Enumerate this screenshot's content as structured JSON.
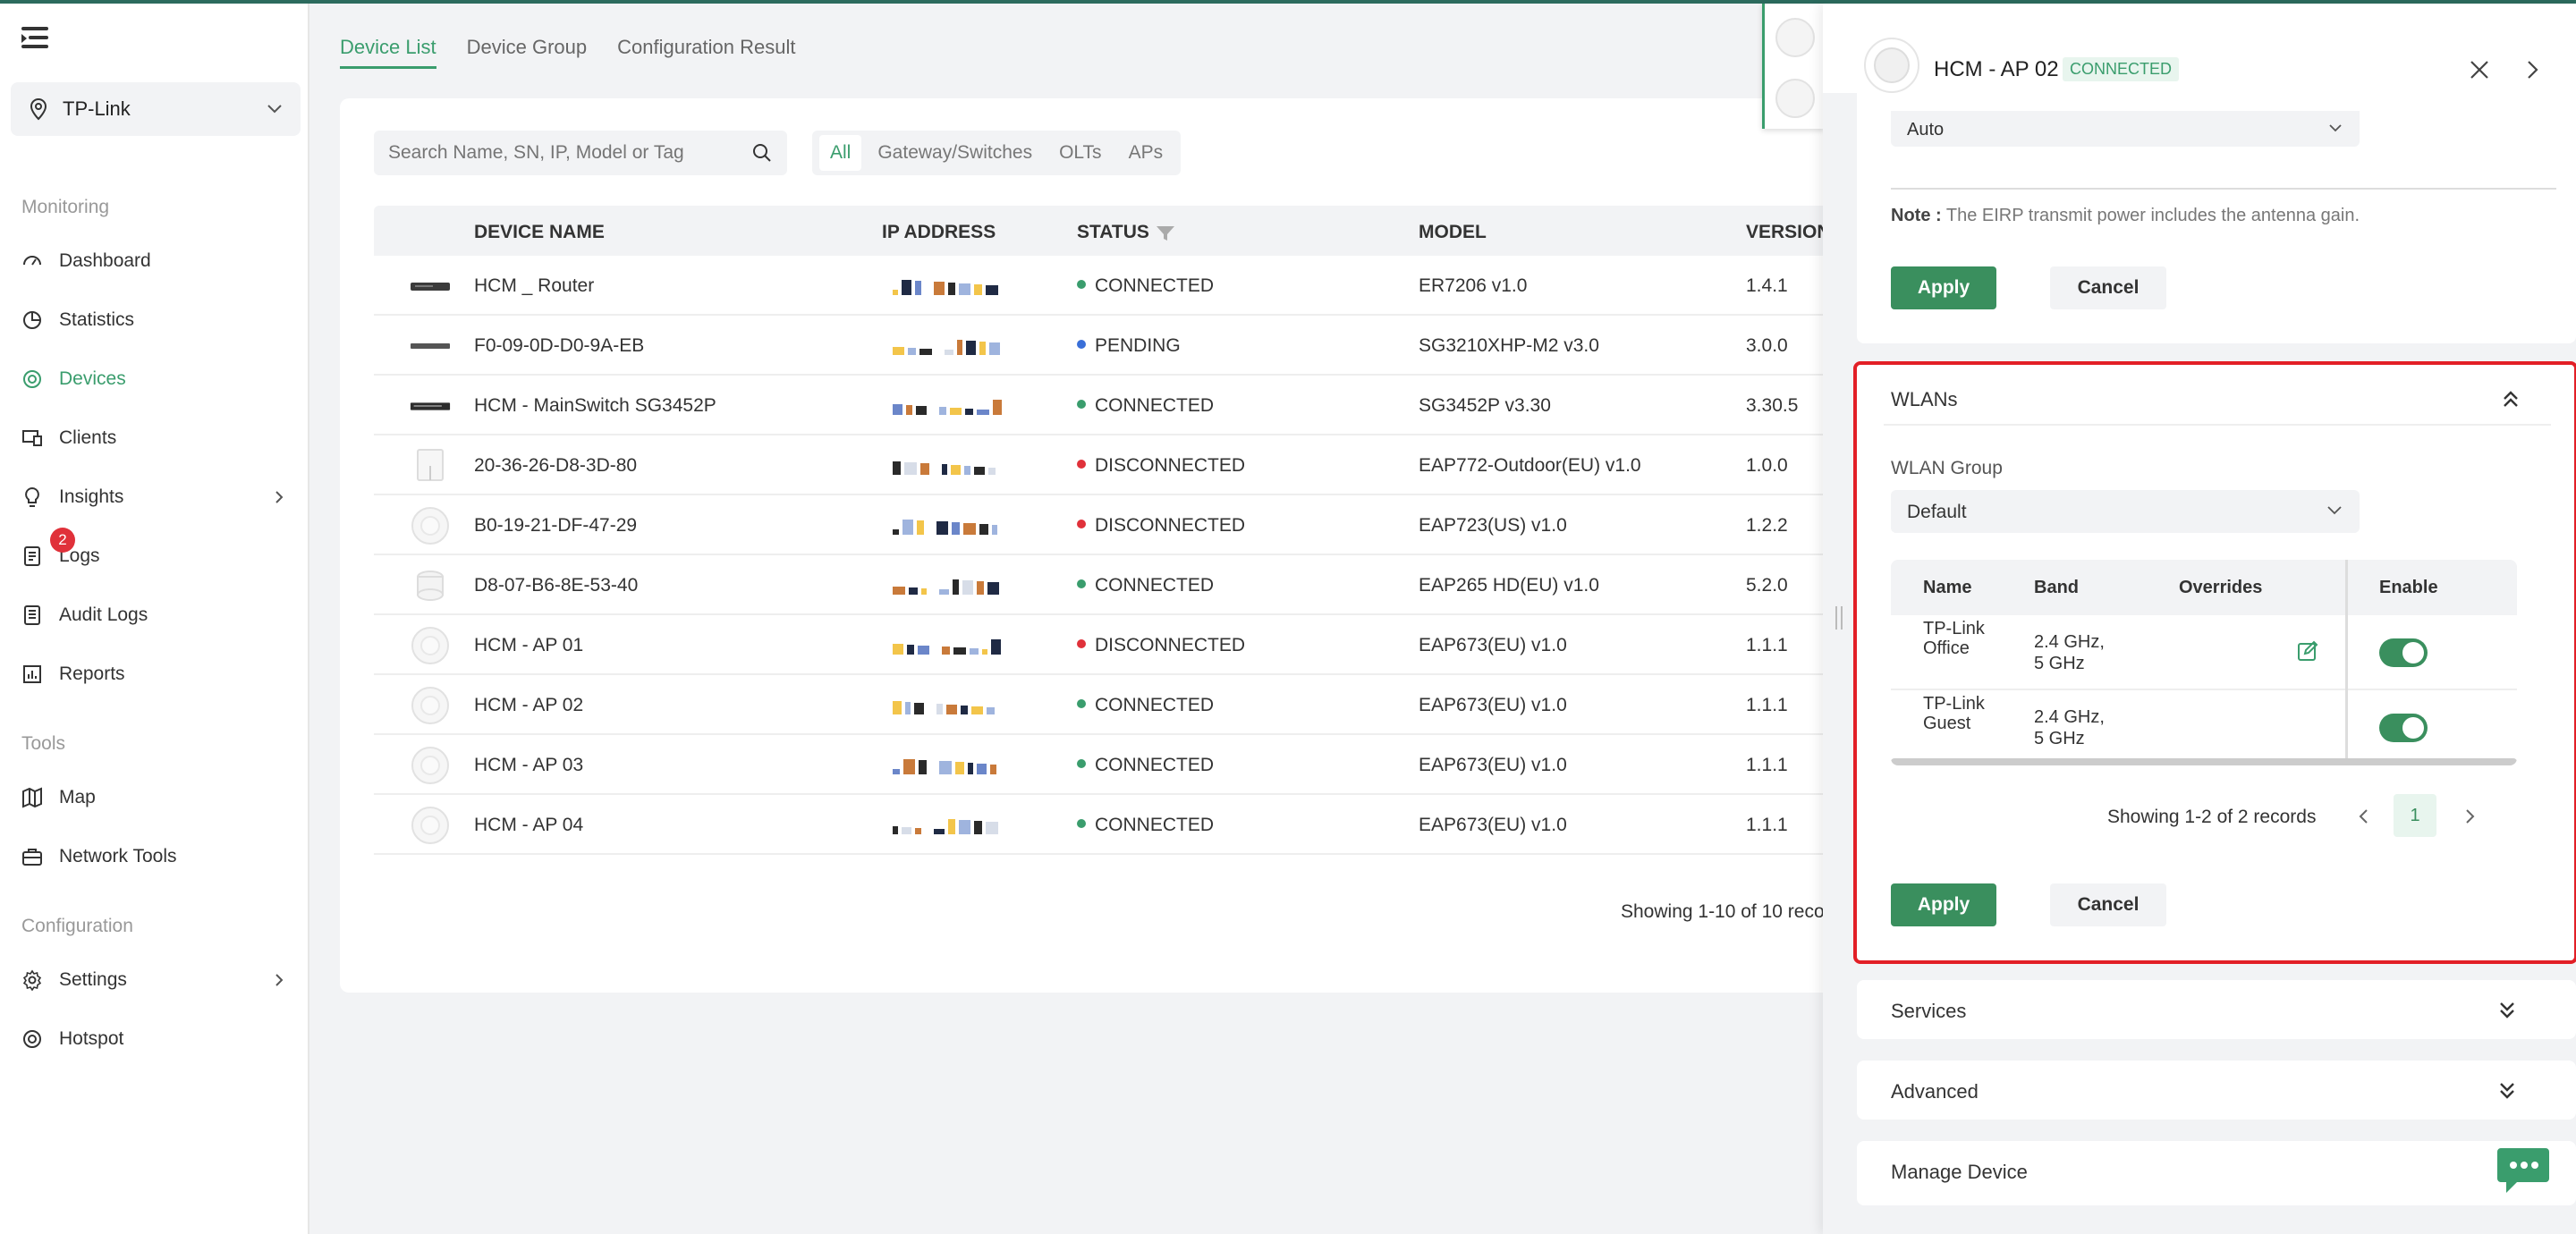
{
  "sidebar": {
    "site": "TP-Link",
    "sections": {
      "monitoring": "Monitoring",
      "tools": "Tools",
      "configuration": "Configuration"
    },
    "items": [
      {
        "label": "Dashboard",
        "icon": "dashboard-icon"
      },
      {
        "label": "Statistics",
        "icon": "pie-chart-icon"
      },
      {
        "label": "Devices",
        "icon": "devices-icon",
        "active": true
      },
      {
        "label": "Clients",
        "icon": "clients-icon"
      },
      {
        "label": "Insights",
        "icon": "bulb-icon"
      },
      {
        "label": "Logs",
        "icon": "logs-icon",
        "badge": "2"
      },
      {
        "label": "Audit Logs",
        "icon": "audit-icon"
      },
      {
        "label": "Reports",
        "icon": "reports-icon"
      },
      {
        "label": "Map",
        "icon": "map-icon"
      },
      {
        "label": "Network Tools",
        "icon": "toolbox-icon"
      },
      {
        "label": "Settings",
        "icon": "gear-icon"
      },
      {
        "label": "Hotspot",
        "icon": "hotspot-icon"
      }
    ]
  },
  "tabs": [
    "Device List",
    "Device Group",
    "Configuration Result"
  ],
  "search": {
    "placeholder": "Search Name, SN, IP, Model or Tag"
  },
  "filters": [
    "All",
    "Gateway/Switches",
    "OLTs",
    "APs"
  ],
  "table": {
    "headers": {
      "name": "DEVICE NAME",
      "ip": "IP ADDRESS",
      "status": "STATUS",
      "model": "MODEL",
      "version": "VERSION"
    },
    "rows": [
      {
        "name": "HCM _ Router",
        "status": "CONNECTED",
        "model": "ER7206 v1.0",
        "version": "1.4.1",
        "type": "router"
      },
      {
        "name": "F0-09-0D-D0-9A-EB",
        "status": "PENDING",
        "model": "SG3210XHP-M2 v3.0",
        "version": "3.0.0",
        "type": "switch-small"
      },
      {
        "name": "HCM - MainSwitch SG3452P",
        "status": "CONNECTED",
        "model": "SG3452P v3.30",
        "version": "3.30.5",
        "type": "switch"
      },
      {
        "name": "20-36-26-D8-3D-80",
        "status": "DISCONNECTED",
        "model": "EAP772-Outdoor(EU) v1.0",
        "version": "1.0.0",
        "type": "outdoor"
      },
      {
        "name": "B0-19-21-DF-47-29",
        "status": "DISCONNECTED",
        "model": "EAP723(US) v1.0",
        "version": "1.2.2",
        "type": "ap"
      },
      {
        "name": "D8-07-B6-8E-53-40",
        "status": "CONNECTED",
        "model": "EAP265 HD(EU) v1.0",
        "version": "5.2.0",
        "type": "ap-stack"
      },
      {
        "name": "HCM - AP 01",
        "status": "DISCONNECTED",
        "model": "EAP673(EU) v1.0",
        "version": "1.1.1",
        "type": "ap"
      },
      {
        "name": "HCM - AP 02",
        "status": "CONNECTED",
        "model": "EAP673(EU) v1.0",
        "version": "1.1.1",
        "type": "ap"
      },
      {
        "name": "HCM - AP 03",
        "status": "CONNECTED",
        "model": "EAP673(EU) v1.0",
        "version": "1.1.1",
        "type": "ap"
      },
      {
        "name": "HCM - AP 04",
        "status": "CONNECTED",
        "model": "EAP673(EU) v1.0",
        "version": "1.1.1",
        "type": "ap"
      }
    ],
    "showing": "Showing 1-10 of 10 reco"
  },
  "status_colors": {
    "CONNECTED": "#3a9d6d",
    "PENDING": "#3a6fd8",
    "DISCONNECTED": "#e0313a"
  },
  "panel": {
    "title": "HCM - AP 02",
    "status": "CONNECTED",
    "radio": {
      "select_value": "Auto",
      "note_label": "Note :",
      "note_text": "The EIRP transmit power includes the antenna gain.",
      "apply": "Apply",
      "cancel": "Cancel"
    },
    "wlans": {
      "title": "WLANs",
      "group_label": "WLAN Group",
      "group_value": "Default",
      "headers": {
        "name": "Name",
        "band": "Band",
        "overrides": "Overrides",
        "enable": "Enable"
      },
      "rows": [
        {
          "name": "TP-Link Office",
          "band_line1": "2.4 GHz,",
          "band_line2": "5 GHz",
          "enabled": true
        },
        {
          "name": "TP-Link Guest",
          "band_line1": "2.4 GHz,",
          "band_line2": "5 GHz",
          "enabled": true
        }
      ],
      "showing": "Showing 1-2 of 2 records",
      "page": "1",
      "apply": "Apply",
      "cancel": "Cancel"
    },
    "sections": [
      "Services",
      "Advanced",
      "Manage Device"
    ]
  },
  "colors": {
    "accent": "#3a9d6d",
    "apply": "#3a8f5e",
    "highlight_border": "#e21f26"
  }
}
